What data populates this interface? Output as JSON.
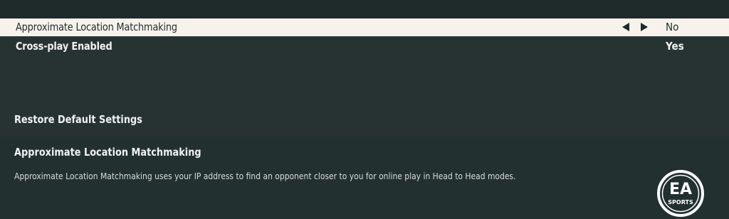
{
  "settings": {
    "rows": [
      {
        "label": "Approximate Location Matchmaking",
        "value": "No",
        "selected": true
      },
      {
        "label": "Cross-play Enabled",
        "value": "Yes",
        "selected": false
      }
    ],
    "restore_label": "Restore Default Settings"
  },
  "info": {
    "title": "Approximate Location Matchmaking",
    "description": "Approximate Location Matchmaking uses your IP address to find an opponent closer to you for online play in Head to Head modes."
  },
  "logo": {
    "line1": "EA",
    "line2": "SPORTS"
  },
  "colors": {
    "background": "#263232",
    "selected_row": "#f7f3ec",
    "text": "#f2f2f2"
  }
}
